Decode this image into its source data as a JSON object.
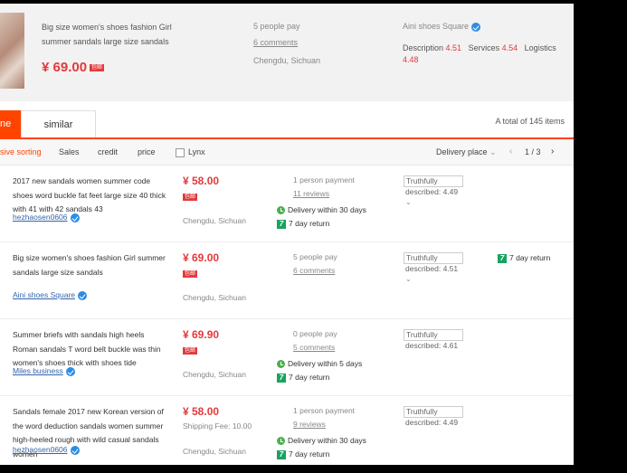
{
  "header": {
    "title": "Big size women's shoes fashion Girl summer sandals large size sandals",
    "price": "¥ 69.00",
    "tag": "包邮",
    "pay": "5 people pay",
    "comments": "6 comments",
    "location": "Chengdu, Sichuan",
    "shop": "Aini shoes Square",
    "desc_label": "Description",
    "desc_val": "4.51",
    "serv_label": "Services",
    "serv_val": "4.54",
    "log_label": "Logistics",
    "log_val": "4.48"
  },
  "tabs": {
    "active": "ne",
    "similar": "similar",
    "total": "A total of 145 items"
  },
  "sortbar": {
    "sorting": "sive sorting",
    "sales": "Sales",
    "credit": "credit",
    "price": "price",
    "lynx": "Lynx",
    "delivery": "Delivery place",
    "page": "1 / 3"
  },
  "rows": [
    {
      "title": "2017 new sandals women summer code shoes word buckle fat feet large size 40 thick with 41 with 42 sandals 43",
      "shop": "hezhaosen0606",
      "price": "¥ 58.00",
      "tag": "包邮",
      "location": "Chengdu, Sichuan",
      "pay": "1 person payment",
      "comments": "11 reviews",
      "delivery": "Delivery within 30 days",
      "ret": "7 day return",
      "desc1": "Truthfully",
      "desc2": "described: 4.49"
    },
    {
      "title": "Big size women's shoes fashion Girl summer sandals large size sandals",
      "shop": "Aini shoes Square",
      "price": "¥ 69.00",
      "tag": "包邮",
      "location": "Chengdu, Sichuan",
      "pay": "5 people pay",
      "comments": "6 comments",
      "desc1": "Truthfully",
      "desc2": "described: 4.51",
      "extra_return": "7 day return"
    },
    {
      "title": "Summer briefs with sandals high heels Roman sandals T word belt buckle was thin women's shoes thick with shoes tide",
      "shop": "Miles business",
      "price": "¥ 69.90",
      "tag": "包邮",
      "location": "Chengdu, Sichuan",
      "pay": "0 people pay",
      "comments": "5 comments",
      "delivery": "Delivery within 5 days",
      "ret": "7 day return",
      "desc1": "Truthfully",
      "desc2": "described: 4.61"
    },
    {
      "title": "Sandals female 2017 new Korean version of the word deduction sandals women summer high-heeled rough with wild casual sandals women",
      "shop": "hezhaosen0606",
      "price": "¥ 58.00",
      "shipping": "Shipping Fee: 10.00",
      "location": "Chengdu, Sichuan",
      "pay": "1 person payment",
      "comments": "9 reviews",
      "delivery": "Delivery within 30 days",
      "ret": "7 day return",
      "desc1": "Truthfully",
      "desc2": "described: 4.49"
    }
  ]
}
